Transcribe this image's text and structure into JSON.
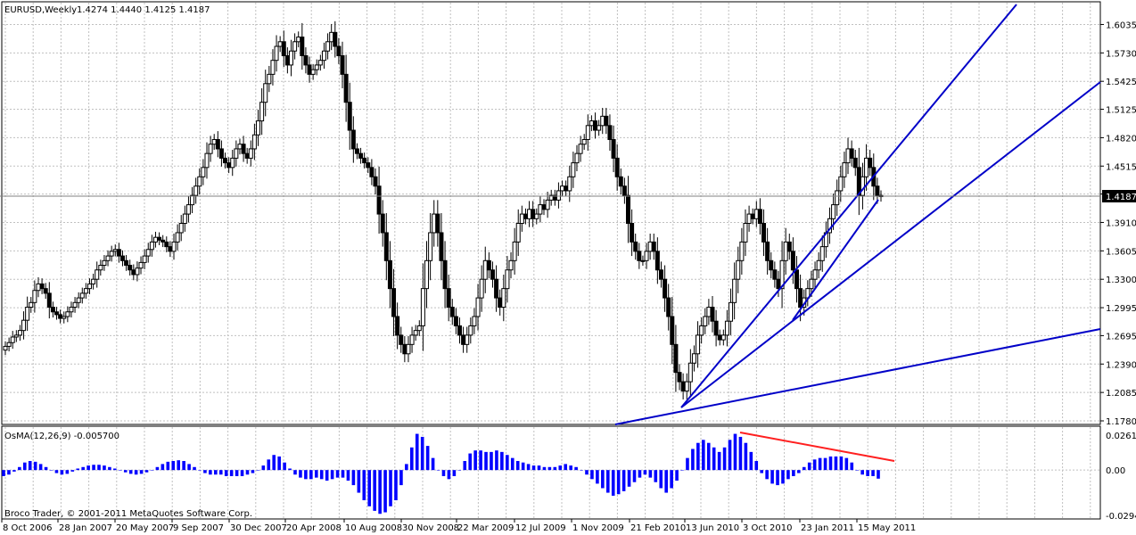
{
  "header": {
    "symbol": "EURUSD,Weekly",
    "ohlc": "1.4274 1.4440 1.4125 1.4187"
  },
  "indicator": {
    "label": "OsMA(12,26,9) -0.005700"
  },
  "copyright": "Broco Trader, © 2001-2011 MetaQuotes Software Corp.",
  "current_price_label": "1.4187",
  "colors": {
    "candle_up": "#ffffff",
    "candle_down": "#000000",
    "fan_lines": "#0000c8",
    "histogram": "#0000ff",
    "divergence_line": "#ff2020",
    "grid": "#c0c0c0"
  },
  "chart_data": [
    {
      "type": "candlestick",
      "series": [
        {
          "name": "EURUSD,Weekly"
        }
      ],
      "x_ticks": [
        "8 Oct 2006",
        "28 Jan 2007",
        "20 May 2007",
        "9 Sep 2007",
        "30 Dec 2007",
        "20 Apr 2008",
        "10 Aug 2008",
        "30 Nov 2008",
        "22 Mar 2009",
        "12 Jul 2009",
        "1 Nov 2009",
        "21 Feb 2010",
        "13 Jun 2010",
        "3 Oct 2010",
        "23 Jan 2011",
        "15 May 2011"
      ],
      "y_ticks": [
        1.178,
        1.2085,
        1.239,
        1.2695,
        1.2995,
        1.33,
        1.3605,
        1.391,
        1.4215,
        1.4515,
        1.482,
        1.5125,
        1.5425,
        1.573,
        1.6035
      ],
      "ylim": [
        1.178,
        1.625
      ],
      "closes": [
        1.258,
        1.262,
        1.268,
        1.27,
        1.275,
        1.286,
        1.3,
        1.305,
        1.318,
        1.325,
        1.32,
        1.315,
        1.3,
        1.295,
        1.292,
        1.288,
        1.29,
        1.295,
        1.3,
        1.305,
        1.31,
        1.315,
        1.32,
        1.325,
        1.33,
        1.34,
        1.345,
        1.35,
        1.355,
        1.36,
        1.362,
        1.355,
        1.35,
        1.345,
        1.34,
        1.335,
        1.342,
        1.348,
        1.355,
        1.362,
        1.37,
        1.375,
        1.372,
        1.37,
        1.365,
        1.36,
        1.37,
        1.38,
        1.39,
        1.4,
        1.41,
        1.42,
        1.43,
        1.44,
        1.45,
        1.465,
        1.475,
        1.48,
        1.47,
        1.46,
        1.455,
        1.45,
        1.46,
        1.47,
        1.475,
        1.465,
        1.46,
        1.47,
        1.485,
        1.5,
        1.52,
        1.54,
        1.55,
        1.565,
        1.58,
        1.585,
        1.57,
        1.56,
        1.575,
        1.585,
        1.59,
        1.57,
        1.56,
        1.55,
        1.555,
        1.56,
        1.565,
        1.575,
        1.585,
        1.595,
        1.58,
        1.57,
        1.55,
        1.52,
        1.49,
        1.47,
        1.465,
        1.46,
        1.455,
        1.45,
        1.44,
        1.43,
        1.4,
        1.38,
        1.35,
        1.32,
        1.29,
        1.27,
        1.26,
        1.25,
        1.26,
        1.27,
        1.275,
        1.28,
        1.32,
        1.35,
        1.38,
        1.4,
        1.38,
        1.35,
        1.32,
        1.3,
        1.29,
        1.28,
        1.27,
        1.26,
        1.27,
        1.28,
        1.29,
        1.31,
        1.33,
        1.35,
        1.34,
        1.33,
        1.31,
        1.3,
        1.32,
        1.34,
        1.35,
        1.37,
        1.39,
        1.4,
        1.395,
        1.405,
        1.395,
        1.4,
        1.41,
        1.405,
        1.415,
        1.42,
        1.415,
        1.425,
        1.43,
        1.425,
        1.44,
        1.455,
        1.465,
        1.475,
        1.48,
        1.495,
        1.5,
        1.49,
        1.495,
        1.505,
        1.495,
        1.48,
        1.46,
        1.44,
        1.43,
        1.42,
        1.39,
        1.37,
        1.36,
        1.35,
        1.35,
        1.36,
        1.37,
        1.36,
        1.34,
        1.33,
        1.31,
        1.29,
        1.26,
        1.23,
        1.22,
        1.21,
        1.22,
        1.24,
        1.25,
        1.27,
        1.28,
        1.29,
        1.3,
        1.285,
        1.27,
        1.265,
        1.27,
        1.285,
        1.305,
        1.33,
        1.35,
        1.37,
        1.39,
        1.4,
        1.395,
        1.405,
        1.39,
        1.37,
        1.35,
        1.34,
        1.33,
        1.32,
        1.35,
        1.37,
        1.36,
        1.34,
        1.32,
        1.3,
        1.31,
        1.32,
        1.33,
        1.34,
        1.35,
        1.365,
        1.38,
        1.395,
        1.41,
        1.425,
        1.44,
        1.455,
        1.47,
        1.46,
        1.45,
        1.42,
        1.44,
        1.46,
        1.45,
        1.43,
        1.42,
        1.4187
      ],
      "fan_lines": [
        {
          "from": [
            "1 Nov 2009",
            "1.1780"
          ],
          "to": [
            "beyond 15 May 2011",
            "1.2750"
          ]
        },
        {
          "from": [
            "13 Jun 2010",
            "1.1900"
          ],
          "to": [
            "beyond 15 May 2011",
            "1.5400"
          ]
        },
        {
          "from": [
            "13 Jun 2010",
            "1.1900"
          ],
          "to": [
            "beyond 15 May 2011",
            "1.6250"
          ]
        },
        {
          "from": [
            "3 Oct 2010",
            "1.2880"
          ],
          "to": [
            "15 May 2011",
            "1.4187"
          ]
        }
      ]
    },
    {
      "type": "bar",
      "series": [
        {
          "name": "OsMA(12,26,9)"
        }
      ],
      "y_ticks": [
        0.0261,
        0.0,
        -0.02944
      ],
      "ylim": [
        -0.02944,
        0.0261
      ],
      "values": [
        -0.004,
        -0.003,
        -0.001,
        0.002,
        0.005,
        0.006,
        0.0055,
        0.004,
        0.002,
        0.0,
        -0.002,
        -0.003,
        -0.0025,
        -0.001,
        0.001,
        0.002,
        0.003,
        0.0035,
        0.0035,
        0.003,
        0.002,
        0.001,
        0.0,
        -0.0015,
        -0.0025,
        -0.003,
        -0.0025,
        -0.0015,
        0.0,
        0.002,
        0.004,
        0.0055,
        0.006,
        0.0065,
        0.006,
        0.004,
        0.002,
        0.0,
        -0.002,
        -0.003,
        -0.003,
        -0.003,
        -0.004,
        -0.004,
        -0.004,
        -0.004,
        -0.003,
        -0.002,
        0.0,
        0.003,
        0.007,
        0.01,
        0.009,
        0.005,
        0.001,
        -0.003,
        -0.005,
        -0.006,
        -0.006,
        -0.005,
        -0.006,
        -0.007,
        -0.006,
        -0.005,
        -0.005,
        -0.007,
        -0.01,
        -0.015,
        -0.02,
        -0.024,
        -0.027,
        -0.029,
        -0.028,
        -0.024,
        -0.02,
        -0.01,
        0.004,
        0.015,
        0.024,
        0.022,
        0.016,
        0.008,
        0.0,
        -0.004,
        -0.006,
        -0.004,
        0.0,
        0.006,
        0.011,
        0.013,
        0.013,
        0.012,
        0.012,
        0.013,
        0.012,
        0.01,
        0.008,
        0.006,
        0.005,
        0.004,
        0.003,
        0.003,
        0.002,
        0.002,
        0.002,
        0.003,
        0.004,
        0.003,
        0.002,
        0.0,
        -0.003,
        -0.006,
        -0.009,
        -0.012,
        -0.015,
        -0.017,
        -0.016,
        -0.014,
        -0.011,
        -0.008,
        -0.005,
        -0.003,
        -0.005,
        -0.008,
        -0.012,
        -0.015,
        -0.012,
        -0.007,
        0.0,
        0.008,
        0.014,
        0.018,
        0.02,
        0.018,
        0.015,
        0.012,
        0.015,
        0.02,
        0.024,
        0.022,
        0.018,
        0.012,
        0.006,
        -0.002,
        -0.006,
        -0.009,
        -0.01,
        -0.009,
        -0.006,
        -0.004,
        -0.002,
        0.002,
        0.005,
        0.007,
        0.008,
        0.008,
        0.009,
        0.009,
        0.009,
        0.008,
        0.005,
        0.0,
        -0.003,
        -0.004,
        -0.004,
        -0.0057
      ]
    }
  ]
}
